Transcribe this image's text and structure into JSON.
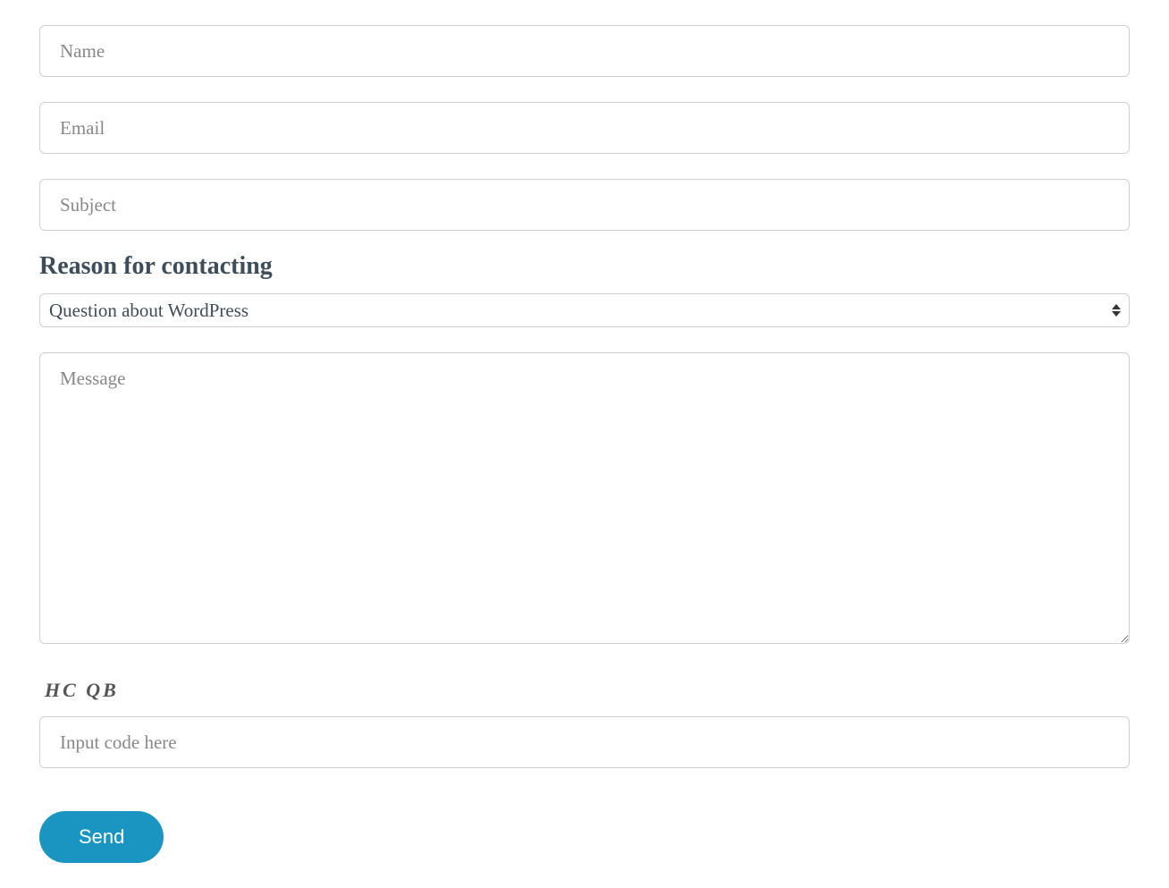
{
  "form": {
    "name": {
      "placeholder": "Name",
      "value": ""
    },
    "email": {
      "placeholder": "Email",
      "value": ""
    },
    "subject": {
      "placeholder": "Subject",
      "value": ""
    },
    "reason": {
      "label": "Reason for contacting",
      "selected": "Question about WordPress"
    },
    "message": {
      "placeholder": "Message",
      "value": ""
    },
    "captcha": {
      "code": "HC QB",
      "placeholder": "Input code here",
      "value": ""
    },
    "submit": {
      "label": "Send"
    }
  }
}
